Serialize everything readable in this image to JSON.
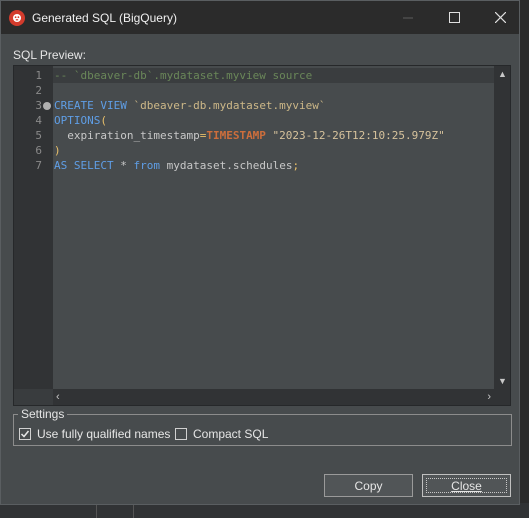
{
  "window": {
    "title": "Generated SQL (BigQuery)"
  },
  "preview": {
    "label": "SQL Preview:"
  },
  "editor": {
    "lines": [
      {
        "n": "1",
        "parts": [
          {
            "t": "-- `dbeaver-db`.mydataset.myview source",
            "c": "comment"
          }
        ]
      },
      {
        "n": "2",
        "parts": []
      },
      {
        "n": "3",
        "parts": [
          {
            "t": "CREATE VIEW ",
            "c": "kw"
          },
          {
            "t": "`dbeaver-db.mydataset.myview`",
            "c": "ident"
          }
        ]
      },
      {
        "n": "4",
        "parts": [
          {
            "t": "OPTIONS",
            "c": "kw"
          },
          {
            "t": "(",
            "c": "op"
          }
        ]
      },
      {
        "n": "5",
        "parts": [
          {
            "t": "  expiration_timestamp",
            "c": "plain"
          },
          {
            "t": "=",
            "c": "op"
          },
          {
            "t": "TIMESTAMP",
            "c": "fn"
          },
          {
            "t": " \"2023-12-26T12:10:25.979Z\"",
            "c": "str"
          }
        ]
      },
      {
        "n": "6",
        "parts": [
          {
            "t": ")",
            "c": "op"
          }
        ]
      },
      {
        "n": "7",
        "parts": [
          {
            "t": "AS SELECT",
            "c": "kw"
          },
          {
            "t": " * ",
            "c": "plain"
          },
          {
            "t": "from",
            "c": "kw"
          },
          {
            "t": " mydataset.schedules",
            "c": "plain"
          },
          {
            "t": ";",
            "c": "op"
          }
        ]
      }
    ]
  },
  "settings": {
    "legend": "Settings",
    "fully_qualified": {
      "label": "Use fully qualified names",
      "checked": true
    },
    "compact": {
      "label": "Compact SQL",
      "checked": false
    }
  },
  "buttons": {
    "copy": "Copy",
    "close": "Close"
  },
  "colors": {
    "comment": "#6a8759",
    "keyword": "#5f9ee6",
    "identifier": "#cdb888",
    "string": "#d6c29c",
    "function": "#cd6e3c"
  }
}
